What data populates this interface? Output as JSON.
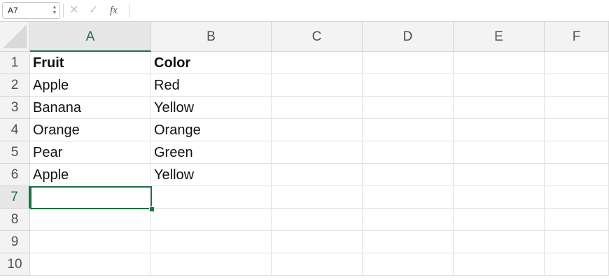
{
  "formula_bar": {
    "name_box": "A7",
    "cancel_icon": "close-icon",
    "enter_icon": "check-icon",
    "function_label": "fx",
    "formula_value": ""
  },
  "columns": [
    "A",
    "B",
    "C",
    "D",
    "E",
    "F"
  ],
  "active_column": "A",
  "rows": [
    "1",
    "2",
    "3",
    "4",
    "5",
    "6",
    "7",
    "8",
    "9",
    "10"
  ],
  "active_row": "7",
  "cells": [
    {
      "ref": "A1",
      "value": "Fruit",
      "bold": true
    },
    {
      "ref": "B1",
      "value": "Color",
      "bold": true
    },
    {
      "ref": "A2",
      "value": "Apple"
    },
    {
      "ref": "B2",
      "value": "Red"
    },
    {
      "ref": "A3",
      "value": "Banana"
    },
    {
      "ref": "B3",
      "value": "Yellow"
    },
    {
      "ref": "A4",
      "value": "Orange"
    },
    {
      "ref": "B4",
      "value": "Orange"
    },
    {
      "ref": "A5",
      "value": "Pear"
    },
    {
      "ref": "B5",
      "value": "Green"
    },
    {
      "ref": "A6",
      "value": "Apple"
    },
    {
      "ref": "B6",
      "value": "Yellow"
    }
  ],
  "colors": {
    "accent": "#1e7145",
    "header_bg": "#f3f3f3",
    "gridline": "#e1e1e1"
  }
}
